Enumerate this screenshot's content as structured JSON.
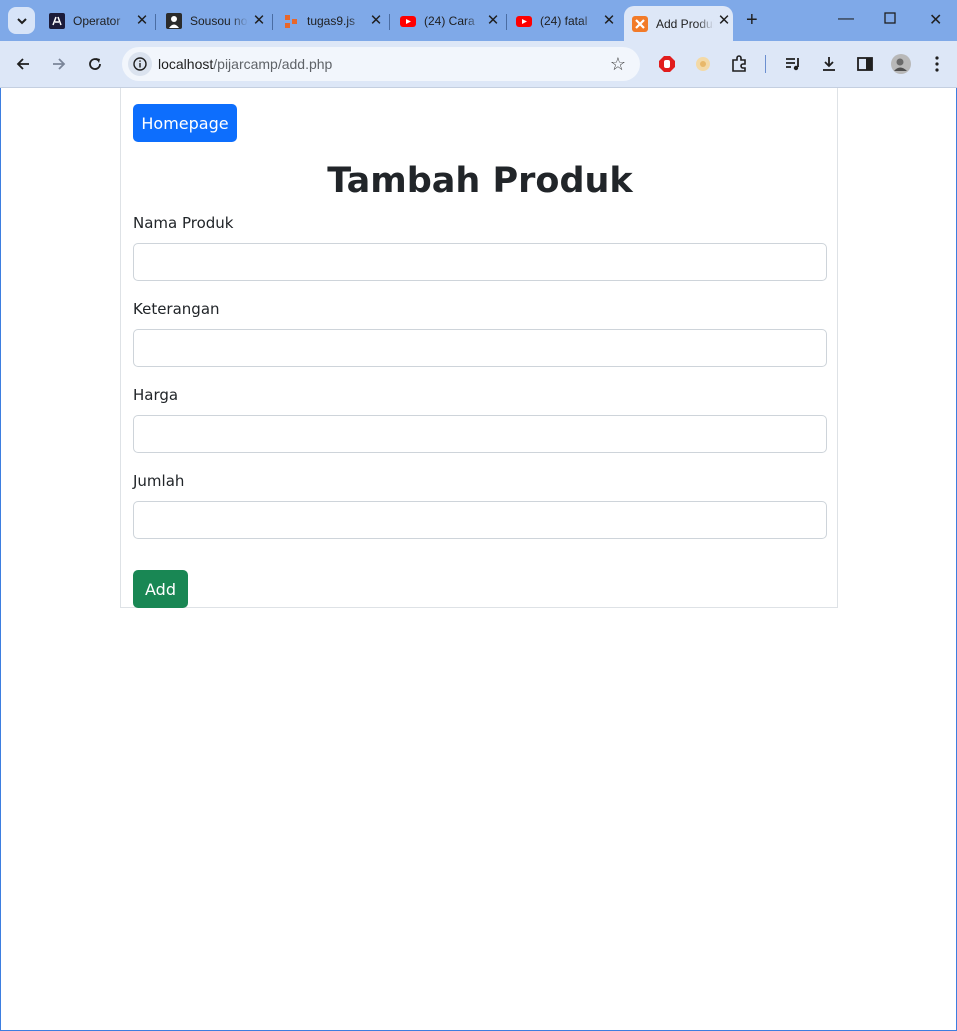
{
  "browser": {
    "tabs": [
      {
        "title": "Operator",
        "favicon": "laravel-icon"
      },
      {
        "title": "Sousou no",
        "favicon": "person-icon"
      },
      {
        "title": "tugas9.js",
        "favicon": "diagram-icon"
      },
      {
        "title": "(24) Cara",
        "favicon": "youtube-icon"
      },
      {
        "title": "(24) fatal",
        "favicon": "youtube-icon"
      },
      {
        "title": "Add Produk",
        "favicon": "xampp-icon",
        "active": true
      }
    ],
    "url_host": "localhost",
    "url_path": "/pijarcamp/add.php",
    "colors": {
      "tabstrip": "#7fa9e8",
      "toolbar": "#dde7f7"
    }
  },
  "page": {
    "homepage_button": "Homepage",
    "title": "Tambah Produk",
    "fields": [
      {
        "label": "Nama Produk",
        "value": ""
      },
      {
        "label": "Keterangan",
        "value": ""
      },
      {
        "label": "Harga",
        "value": ""
      },
      {
        "label": "Jumlah",
        "value": ""
      }
    ],
    "add_button": "Add",
    "colors": {
      "primary": "#0d6efd",
      "success": "#198754"
    }
  }
}
